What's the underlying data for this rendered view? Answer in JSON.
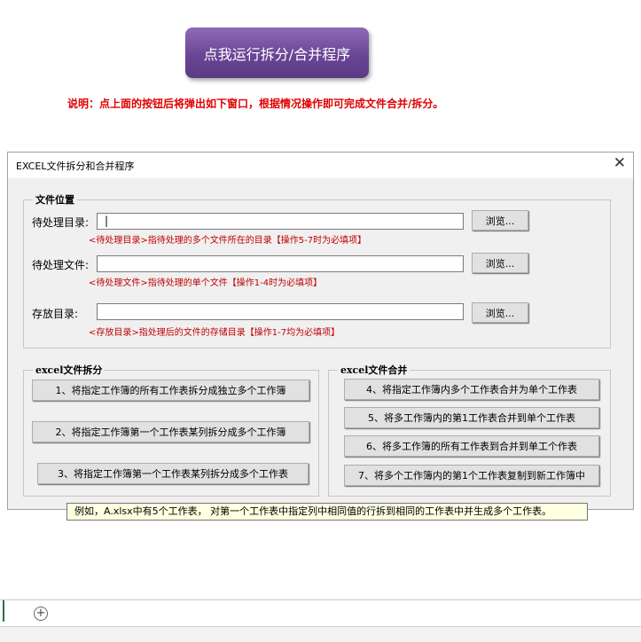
{
  "run_button": {
    "label": "点我运行拆分/合并程序"
  },
  "note": "说明：点上面的按钮后将弹出如下窗口，根据情况操作即可完成文件合并/拆分。",
  "dialog": {
    "title": "EXCEL文件拆分和合并程序",
    "close": "✕",
    "file_location": {
      "legend": "文件位置",
      "rows": [
        {
          "label": "待处理目录:",
          "value": "|",
          "browse": "浏览...",
          "hint": "<待处理目录>指待处理的多个文件所在的目录【操作5-7时为必填项】"
        },
        {
          "label": "待处理文件:",
          "value": "",
          "browse": "浏览...",
          "hint": "<待处理文件>指待处理的单个文件【操作1-4时为必填项】"
        },
        {
          "label": "存放目录:",
          "value": "",
          "browse": "浏览...",
          "hint": "<存放目录>指处理后的文件的存储目录【操作1-7均为必填项】"
        }
      ]
    },
    "split_group": {
      "legend": "excel文件拆分",
      "buttons": [
        "1、将指定工作簿的所有工作表拆分成独立多个工作簿",
        "2、将指定工作簿第一个工作表某列拆分成多个工作簿",
        "3、将指定工作簿第一个工作表某列拆分成多个工作表"
      ]
    },
    "merge_group": {
      "legend": "excel文件合并",
      "buttons": [
        "4、将指定工作簿内多个工作表合并为单个工作表",
        "5、将多工作簿内的第1工作表合并到单个工作表",
        "6、将多工作簿的所有工作表到合并到单工个作表",
        "7、将多个工作簿内的第1个工作表复制到新工作簿中"
      ]
    }
  },
  "tooltip": "例如，A.xlsx中有5个工作表， 对第一个工作表中指定列中相同值的行拆到相同的工作表中并生成多个工作表。",
  "sheetbar": {
    "add_icon": "+"
  }
}
